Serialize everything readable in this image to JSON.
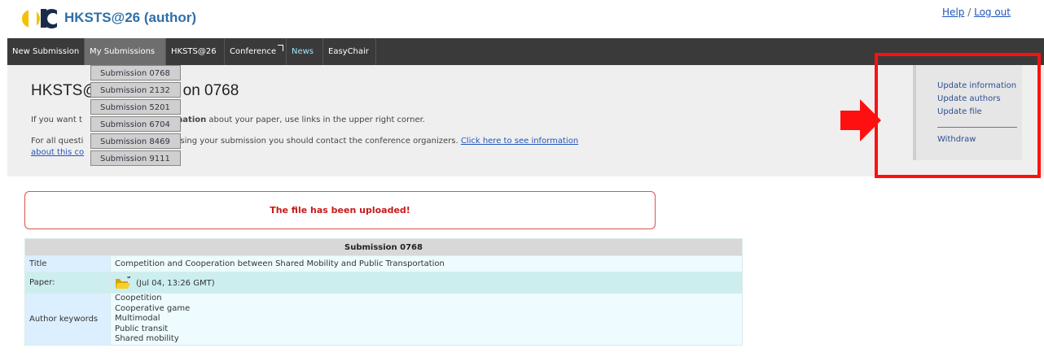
{
  "app": {
    "title": "HKSTS@26 (author)",
    "logo_icon": "easychair-logo-icon"
  },
  "toplinks": {
    "help": "Help",
    "sep": "/",
    "logout": "Log out"
  },
  "nav": {
    "items": [
      {
        "label": "New Submission"
      },
      {
        "label": "My Submissions"
      },
      {
        "label": "HKSTS@26"
      },
      {
        "label": "Conference"
      },
      {
        "label": "News"
      },
      {
        "label": "EasyChair"
      }
    ],
    "active": "My Submissions"
  },
  "dropdown": {
    "items": [
      "Submission 0768",
      "Submission 2132",
      "Submission 5201",
      "Submission 6704",
      "Submission 8469",
      "Submission 9111"
    ]
  },
  "page": {
    "title_left": "HKSTS@",
    "title_right": "on 0768",
    "p1_left": "If you want t",
    "p1_bold": "mation",
    "p1_right": " about your paper, use links in the upper right corner.",
    "p2_left": "For all questi",
    "p2_mid": "sing your submission you should contact the conference organizers. ",
    "p2_link": "Click here to see information",
    "p2_link2": "about this co"
  },
  "sidebar": {
    "update_information": "Update information",
    "update_authors": "Update authors",
    "update_file": "Update file",
    "withdraw": "Withdraw"
  },
  "annotation": {
    "arrow_color": "#ff1010",
    "box_color": "#ff1010"
  },
  "message": "The file has been uploaded!",
  "submission": {
    "header": "Submission 0768",
    "title_label": "Title",
    "title_value": "Competition and Cooperation between Shared Mobility and Public Transportation",
    "paper_label": "Paper:",
    "paper_value": "(Jul 04, 13:26 GMT)",
    "paper_icon": "folder-icon",
    "keywords_label": "Author keywords",
    "keywords": [
      "Coopetition",
      "Cooperative game",
      "Multimodal",
      "Public transit",
      "Shared mobility"
    ]
  }
}
